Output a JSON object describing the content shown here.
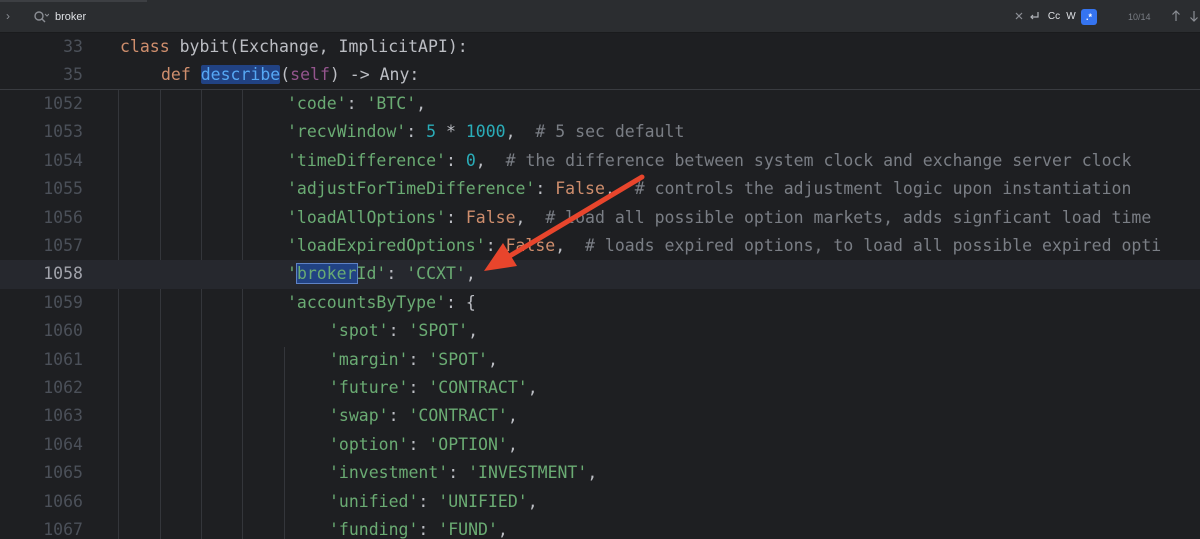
{
  "search": {
    "query": "broker",
    "match_case_label": "Cc",
    "words_label": "W",
    "regex_label": ".*",
    "match_count": "10/14"
  },
  "editor": {
    "sticky_lines": [
      {
        "number": "33",
        "prefix": "class ",
        "name": "bybit",
        "rest": "(Exchange, ImplicitAPI):"
      },
      {
        "number": "35",
        "prefix": "def ",
        "name": "describe",
        "paren": "(",
        "self": "self",
        "rest": ") -> Any:"
      }
    ],
    "lines": [
      {
        "number": "1052",
        "key": "'code'",
        "sep": ": ",
        "value": "'BTC'",
        "tail": ","
      },
      {
        "number": "1053",
        "key": "'recvWindow'",
        "sep": ": ",
        "n1": "5",
        "op": " * ",
        "n2": "1000",
        "tail": ",  ",
        "comment": "# 5 sec default"
      },
      {
        "number": "1054",
        "key": "'timeDifference'",
        "sep": ": ",
        "n1": "0",
        "tail": ",  ",
        "comment": "# the difference between system clock and exchange server clock"
      },
      {
        "number": "1055",
        "key": "'adjustForTimeDifference'",
        "sep": ": ",
        "kw": "False",
        "tail": ",  ",
        "comment": "# controls the adjustment logic upon instantiation"
      },
      {
        "number": "1056",
        "key": "'loadAllOptions'",
        "sep": ": ",
        "kw": "False",
        "tail": ",  ",
        "comment": "# load all possible option markets, adds signficant load time"
      },
      {
        "number": "1057",
        "key": "'loadExpiredOptions'",
        "sep": ": ",
        "kw": "False",
        "tail": ",  ",
        "comment": "# loads expired options, to load all possible expired opti"
      },
      {
        "number": "1058",
        "key_open": "'",
        "match": "broker",
        "key_close": "Id'",
        "sep": ": ",
        "value": "'CCXT'",
        "tail": ","
      },
      {
        "number": "1059",
        "key": "'accountsByType'",
        "sep": ": ",
        "tail": "{"
      },
      {
        "number": "1060",
        "key": "'spot'",
        "sep": ": ",
        "value": "'SPOT'",
        "tail": ","
      },
      {
        "number": "1061",
        "key": "'margin'",
        "sep": ": ",
        "value": "'SPOT'",
        "tail": ","
      },
      {
        "number": "1062",
        "key": "'future'",
        "sep": ": ",
        "value": "'CONTRACT'",
        "tail": ","
      },
      {
        "number": "1063",
        "key": "'swap'",
        "sep": ": ",
        "value": "'CONTRACT'",
        "tail": ","
      },
      {
        "number": "1064",
        "key": "'option'",
        "sep": ": ",
        "value": "'OPTION'",
        "tail": ","
      },
      {
        "number": "1065",
        "key": "'investment'",
        "sep": ": ",
        "value": "'INVESTMENT'",
        "tail": ","
      },
      {
        "number": "1066",
        "key": "'unified'",
        "sep": ": ",
        "value": "'UNIFIED'",
        "tail": ","
      },
      {
        "number": "1067",
        "key": "'funding'",
        "sep": ": ",
        "value": "'FUND'",
        "tail": ","
      }
    ]
  },
  "colors": {
    "annotation_arrow": "#e8452c",
    "search_highlight": "#214283"
  }
}
